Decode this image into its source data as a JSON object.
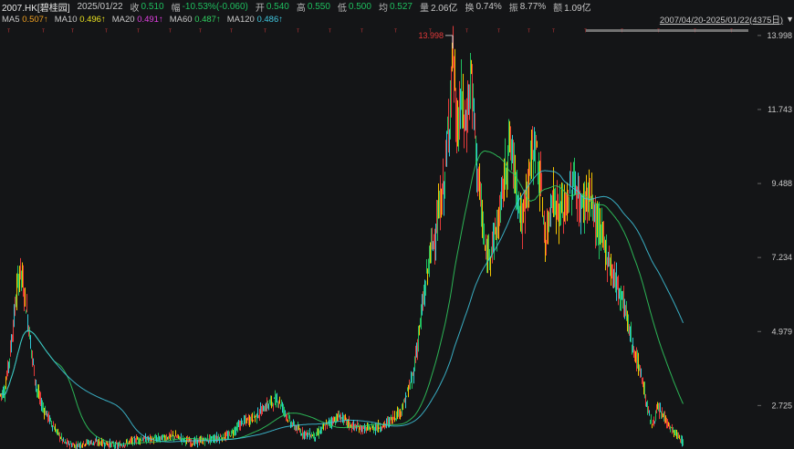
{
  "info": {
    "title": "2007.HK[碧桂园]",
    "date": "2025/01/22",
    "close_label": "收",
    "close": "0.510",
    "change_label": "幅",
    "change": "-10.53%(-0.060)",
    "open_label": "开",
    "open": "0.540",
    "high_label": "高",
    "high": "0.550",
    "low_label": "低",
    "low": "0.500",
    "avg_label": "均",
    "avg": "0.527",
    "volume_label": "量",
    "volume": "2.06亿",
    "turnover_label": "换",
    "turnover": "0.74%",
    "amplitude_label": "振",
    "amplitude": "8.77%",
    "amount_label": "额",
    "amount": "1.09亿"
  },
  "ma": [
    {
      "label": "MA5",
      "value": "0.507↑",
      "color": "#f0a020"
    },
    {
      "label": "MA10",
      "value": "0.496↑",
      "color": "#e8e020"
    },
    {
      "label": "MA20",
      "value": "0.491↑",
      "color": "#e040e0"
    },
    {
      "label": "MA60",
      "value": "0.487↑",
      "color": "#30d060"
    },
    {
      "label": "MA120",
      "value": "0.486↑",
      "color": "#40c8e0"
    }
  ],
  "range": {
    "text": "2007/04/20-2025/01/22(4375日)",
    "arrow_icon": "triangle-down-icon"
  },
  "chart_data": {
    "type": "line",
    "y_ticks": [
      "13.998",
      "11.743",
      "9.488",
      "7.234",
      "4.979",
      "2.725"
    ],
    "high_marker": "13.998",
    "ylim": [
      1.4,
      14.3
    ],
    "x_span_days": 4375,
    "up_color": "#e43a3a",
    "down_color": "#1fbf5f",
    "ma_colors": [
      "#f0a020",
      "#e8e020",
      "#e040e0",
      "#30d060",
      "#40c8e0"
    ],
    "price_path": [
      [
        0,
        3.05
      ],
      [
        5,
        3.2
      ],
      [
        12,
        4.6
      ],
      [
        18,
        6.2
      ],
      [
        22,
        6.9
      ],
      [
        25,
        6.4
      ],
      [
        30,
        5.4
      ],
      [
        35,
        4.2
      ],
      [
        40,
        3.2
      ],
      [
        46,
        2.7
      ],
      [
        52,
        2.4
      ],
      [
        60,
        2.0
      ],
      [
        70,
        1.6
      ],
      [
        82,
        1.5
      ],
      [
        95,
        1.6
      ],
      [
        110,
        1.6
      ],
      [
        130,
        1.5
      ],
      [
        150,
        1.7
      ],
      [
        170,
        1.7
      ],
      [
        190,
        1.8
      ],
      [
        210,
        1.6
      ],
      [
        230,
        1.7
      ],
      [
        250,
        1.8
      ],
      [
        265,
        2.2
      ],
      [
        280,
        2.4
      ],
      [
        295,
        2.8
      ],
      [
        305,
        2.9
      ],
      [
        318,
        2.2
      ],
      [
        330,
        1.9
      ],
      [
        345,
        1.8
      ],
      [
        360,
        2.2
      ],
      [
        372,
        2.4
      ],
      [
        385,
        2.1
      ],
      [
        400,
        2.0
      ],
      [
        420,
        2.1
      ],
      [
        440,
        2.6
      ],
      [
        452,
        3.6
      ],
      [
        462,
        5.6
      ],
      [
        470,
        7.2
      ],
      [
        478,
        8.2
      ],
      [
        486,
        9.4
      ],
      [
        492,
        11.5
      ],
      [
        496,
        13.6
      ],
      [
        500,
        11.0
      ],
      [
        505,
        12.0
      ],
      [
        510,
        11.2
      ],
      [
        516,
        12.8
      ],
      [
        522,
        10.2
      ],
      [
        528,
        8.4
      ],
      [
        532,
        7.2
      ],
      [
        538,
        7.6
      ],
      [
        545,
        8.2
      ],
      [
        552,
        9.6
      ],
      [
        558,
        10.8
      ],
      [
        565,
        9.6
      ],
      [
        572,
        8.2
      ],
      [
        578,
        9.6
      ],
      [
        586,
        10.8
      ],
      [
        592,
        9.4
      ],
      [
        598,
        7.6
      ],
      [
        604,
        9.2
      ],
      [
        612,
        8.6
      ],
      [
        620,
        8.8
      ],
      [
        628,
        9.6
      ],
      [
        636,
        8.7
      ],
      [
        645,
        9.2
      ],
      [
        652,
        8.4
      ],
      [
        660,
        7.8
      ],
      [
        668,
        7.0
      ],
      [
        676,
        6.4
      ],
      [
        684,
        5.8
      ],
      [
        690,
        4.9
      ],
      [
        696,
        4.2
      ],
      [
        703,
        3.6
      ],
      [
        708,
        2.8
      ],
      [
        714,
        2.1
      ],
      [
        720,
        2.6
      ],
      [
        727,
        2.4
      ],
      [
        735,
        2.0
      ],
      [
        742,
        1.8
      ],
      [
        748,
        1.6
      ]
    ]
  }
}
